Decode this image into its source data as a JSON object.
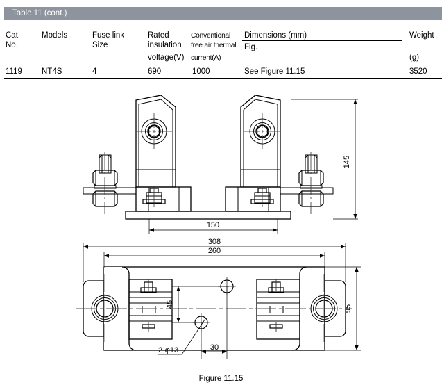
{
  "table": {
    "banner_label": "Table 11 (cont.)",
    "columns": [
      {
        "id": "cat-no",
        "lines": [
          "Cat.",
          "No."
        ]
      },
      {
        "id": "models",
        "lines": [
          "Models"
        ]
      },
      {
        "id": "fuse-link-size",
        "lines": [
          "Fuse link",
          "Size"
        ]
      },
      {
        "id": "rated-insulation-voltage",
        "lines": [
          "Rated",
          "insulation",
          "voltage(V)"
        ]
      },
      {
        "id": "conventional-free-air-thermal-current",
        "lines": [
          "Conventional",
          "free air thermal",
          "current(A)"
        ]
      },
      {
        "id": "dimensions",
        "lines": [
          "Dimensions (mm)",
          "Fig."
        ]
      },
      {
        "id": "weight",
        "lines": [
          "Weight",
          "(g)"
        ]
      }
    ],
    "row": {
      "cat_no": "1119",
      "models": "NT4S",
      "fuse_link_size": "4",
      "rated_insulation_voltage": "690",
      "conventional_free_air_thermal_current": "1000",
      "dimensions": "See Figure 11.15",
      "weight": "3520"
    }
  },
  "figure": {
    "caption": "Figure 11.15",
    "front_view": {
      "dim_height": "145",
      "dim_center_distance": "150"
    },
    "plan_view": {
      "dim_overall_length": "308",
      "dim_mounting_length": "260",
      "dim_overall_width": "95",
      "dim_hole_vertical": "45",
      "dim_hole_horizontal": "30",
      "hole_callout": "2-φ13"
    }
  },
  "colors": {
    "banner": "#8d949d",
    "banner_text": "#ffffff",
    "line": "#000000",
    "centerline": "#555555",
    "page": "#ffffff"
  }
}
